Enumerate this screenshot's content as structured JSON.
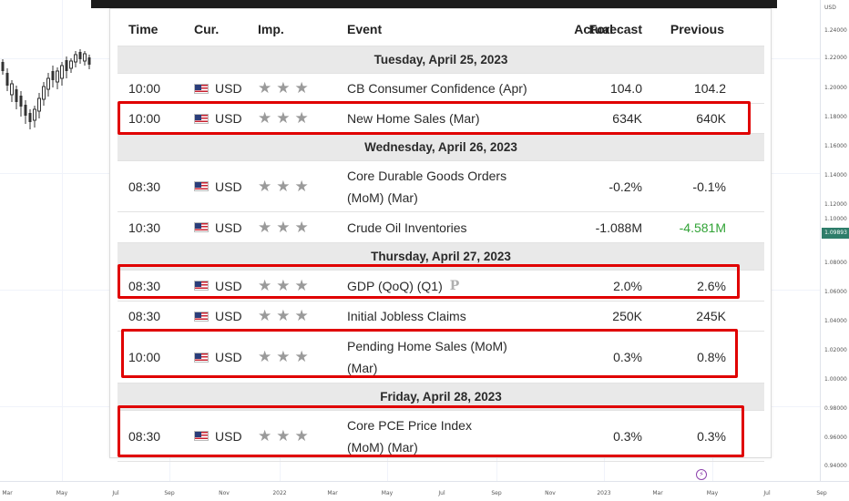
{
  "calendar": {
    "headers": {
      "time": "Time",
      "currency": "Cur.",
      "importance": "Imp.",
      "event": "Event",
      "actual": "Actual",
      "forecast": "Forecast",
      "previous": "Previous"
    },
    "days": [
      {
        "date": "Tuesday, April 25, 2023",
        "events": [
          {
            "time": "10:00",
            "currency": "USD",
            "event": "CB Consumer Confidence (Apr)",
            "actual": "",
            "forecast": "104.0",
            "previous": "104.2",
            "stars": 3
          },
          {
            "time": "10:00",
            "currency": "USD",
            "event": "New Home Sales (Mar)",
            "actual": "",
            "forecast": "634K",
            "previous": "640K",
            "stars": 3
          }
        ]
      },
      {
        "date": "Wednesday, April 26, 2023",
        "events": [
          {
            "time": "08:30",
            "currency": "USD",
            "event": "Core Durable Goods Orders (MoM) (Mar)",
            "actual": "",
            "forecast": "-0.2%",
            "previous": "-0.1%",
            "stars": 3
          },
          {
            "time": "10:30",
            "currency": "USD",
            "event": "Crude Oil Inventories",
            "actual": "",
            "forecast": "-1.088M",
            "previous": "-4.581M",
            "stars": 3
          }
        ]
      },
      {
        "date": "Thursday, April 27, 2023",
        "events": [
          {
            "time": "08:30",
            "currency": "USD",
            "event": "GDP (QoQ) (Q1)",
            "badge": "P",
            "actual": "",
            "forecast": "2.0%",
            "previous": "2.6%",
            "stars": 3
          },
          {
            "time": "08:30",
            "currency": "USD",
            "event": "Initial Jobless Claims",
            "actual": "",
            "forecast": "250K",
            "previous": "245K",
            "stars": 3
          },
          {
            "time": "10:00",
            "currency": "USD",
            "event": "Pending Home Sales (MoM) (Mar)",
            "actual": "",
            "forecast": "0.3%",
            "previous": "0.8%",
            "stars": 3
          }
        ]
      },
      {
        "date": "Friday, April 28, 2023",
        "events": [
          {
            "time": "08:30",
            "currency": "USD",
            "event": "Core PCE Price Index (MoM) (Mar)",
            "actual": "",
            "forecast": "0.3%",
            "previous": "0.3%",
            "stars": 3
          }
        ]
      }
    ]
  },
  "colors": {
    "highlight": "#e00000",
    "positive": "#31a336",
    "date_row_bg": "#e9e9e9",
    "current_price_bg": "#2e7d6a"
  },
  "price_axis": {
    "unit": "USD",
    "ticks": [
      "1.24000",
      "1.22000",
      "1.20000",
      "1.18000",
      "1.16000",
      "1.14000",
      "1.12000",
      "1.10000",
      "1.08000",
      "1.06000",
      "1.04000",
      "1.02000",
      "1.00000",
      "0.98000",
      "0.96000",
      "0.94000"
    ],
    "current": "1.09893"
  },
  "time_axis": {
    "ticks": [
      "Mar",
      "May",
      "Jul",
      "Sep",
      "Nov",
      "2022",
      "Mar",
      "May",
      "Jul",
      "Sep",
      "Nov",
      "2023",
      "Mar",
      "May",
      "Jul",
      "Sep"
    ]
  },
  "icons": {
    "flag": "us-flag-icon",
    "star": "star-icon",
    "bolt": "lightning-icon"
  }
}
